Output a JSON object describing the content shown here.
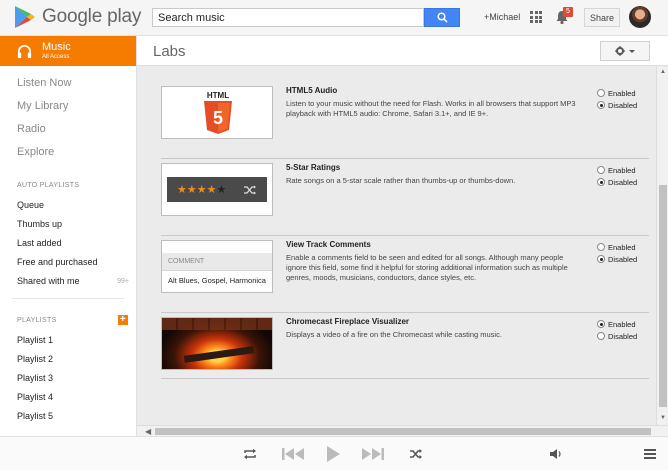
{
  "header": {
    "logo_text": "Google play",
    "search_value": "Search music",
    "user": "+Michael",
    "notification_count": "5",
    "share_label": "Share"
  },
  "sidebar": {
    "brand": "Music",
    "brand_sub": "All Access",
    "nav": [
      "Listen Now",
      "My Library",
      "Radio",
      "Explore"
    ],
    "auto_playlists_heading": "AUTO PLAYLISTS",
    "auto_playlists": [
      {
        "label": "Queue",
        "count": ""
      },
      {
        "label": "Thumbs up",
        "count": ""
      },
      {
        "label": "Last added",
        "count": ""
      },
      {
        "label": "Free and purchased",
        "count": ""
      },
      {
        "label": "Shared with me",
        "count": "99+"
      }
    ],
    "playlists_heading": "PLAYLISTS",
    "add_label": "+",
    "playlists": [
      "Playlist 1",
      "Playlist 2",
      "Playlist 3",
      "Playlist 4",
      "Playlist 5"
    ]
  },
  "main": {
    "title": "Labs"
  },
  "labs": [
    {
      "title": "HTML5 Audio",
      "description": "Listen to your music without the need for Flash. Works in all browsers that support MP3 playback with HTML5 audio: Chrome, Safari 3.1+, and IE 9+.",
      "enabled_label": "Enabled",
      "disabled_label": "Disabled",
      "selected": "Disabled",
      "thumb_text": "HTML"
    },
    {
      "title": "5-Star Ratings",
      "description": "Rate songs on a 5-star scale rather than thumbs-up or thumbs-down.",
      "enabled_label": "Enabled",
      "disabled_label": "Disabled",
      "selected": "Disabled",
      "stars_filled": 4,
      "stars_total": 5
    },
    {
      "title": "View Track Comments",
      "description": "Enable a comments field to be seen and edited for all songs. Although many people ignore this field, some find it helpful for storing additional information such as multiple genres, moods, musicians, conductors, dance styles, etc.",
      "enabled_label": "Enabled",
      "disabled_label": "Disabled",
      "selected": "Disabled",
      "thumb_header": "COMMENT",
      "thumb_body": "Alt Blues, Gospel, Harmonica"
    },
    {
      "title": "Chromecast Fireplace Visualizer",
      "description": "Displays a video of a fire on the Chromecast while casting music.",
      "enabled_label": "Enabled",
      "disabled_label": "Disabled",
      "selected": "Enabled"
    }
  ],
  "colors": {
    "accent": "#f57c00",
    "search_button": "#4285f4",
    "badge": "#dd4b39"
  }
}
